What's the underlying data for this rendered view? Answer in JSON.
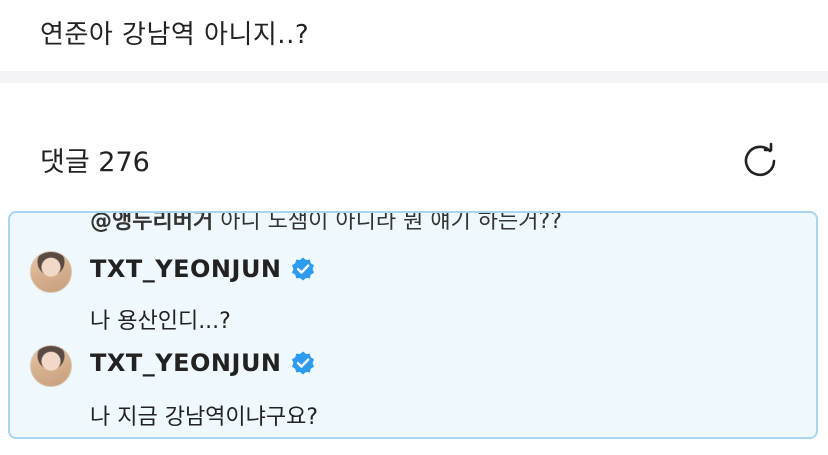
{
  "post": {
    "title": "연준아 강남역 아니지..?"
  },
  "comments": {
    "header": "댓글 276",
    "refresh_icon": "refresh-icon",
    "reply_context": {
      "mention": "@앵두리버거",
      "text": " 아니 노샘이 아니라 뭔 얘기 하는거??"
    },
    "items": [
      {
        "author": "TXT_YEONJUN",
        "verified_icon": "verified-badge-icon",
        "text": "나 용산인디...?"
      },
      {
        "author": "TXT_YEONJUN",
        "verified_icon": "verified-badge-icon",
        "text": "나 지금 강남역이냐구요?"
      }
    ]
  },
  "colors": {
    "highlight_bg": "#eff8fd",
    "highlight_border": "#a7d6ef",
    "verified": "#2d9bf0"
  }
}
